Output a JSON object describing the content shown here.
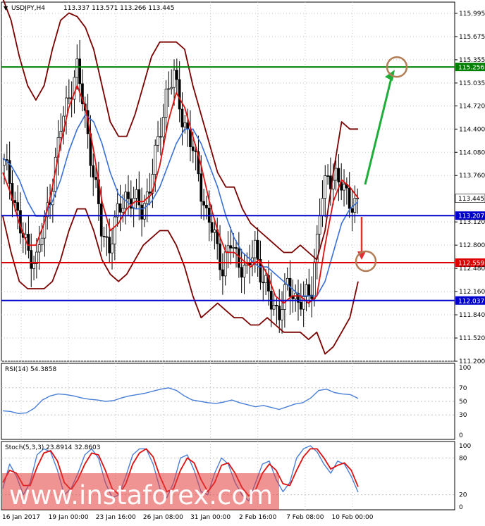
{
  "chart_data": [
    {
      "type": "candlestick",
      "title": "USDJPY,H4",
      "ohlc_text": "113.337 113.571 113.266 113.445",
      "ylim": [
        111.2,
        116.15
      ],
      "y_ticks": [
        "115.995",
        "115.675",
        "115.355",
        "115.035",
        "114.720",
        "114.400",
        "114.080",
        "113.760",
        "113.120",
        "112.800",
        "112.480",
        "112.160",
        "111.840",
        "111.520",
        "111.200"
      ],
      "x_ticks": [
        "16 Jan 2017",
        "19 Jan 00:00",
        "23 Jan 16:00",
        "26 Jan 08:00",
        "31 Jan 00:00",
        "2 Feb 16:00",
        "7 Feb 08:00",
        "10 Feb 00:00"
      ],
      "current_price": {
        "label": "113.445",
        "value": 113.445,
        "color": "#000000"
      },
      "levels": [
        {
          "label": "115.256",
          "value": 115.256,
          "color": "#008000"
        },
        {
          "label": "113.207",
          "value": 113.207,
          "color": "#0000cc"
        },
        {
          "label": "112.559",
          "value": 112.559,
          "color": "#dd0000"
        },
        {
          "label": "112.037",
          "value": 112.037,
          "color": "#0000cc"
        }
      ],
      "close_series": [
        113.9,
        113.6,
        113.0,
        112.7,
        112.6,
        113.1,
        113.7,
        114.4,
        114.9,
        115.2,
        114.6,
        113.8,
        113.0,
        112.8,
        113.2,
        113.5,
        113.4,
        113.3,
        113.6,
        114.2,
        114.9,
        115.1,
        114.6,
        114.2,
        113.8,
        113.2,
        112.9,
        112.5,
        112.8,
        112.6,
        112.4,
        112.8,
        112.3,
        112.0,
        111.9,
        112.2,
        112.1,
        112.0,
        112.2,
        113.3,
        113.7,
        113.8,
        113.5,
        113.4
      ],
      "ma_red": [
        113.8,
        113.5,
        113.1,
        112.8,
        112.8,
        113.1,
        113.6,
        114.2,
        114.7,
        115.0,
        114.7,
        114.1,
        113.4,
        113.0,
        113.1,
        113.3,
        113.4,
        113.4,
        113.5,
        113.9,
        114.5,
        114.9,
        114.7,
        114.3,
        113.9,
        113.4,
        113.0,
        112.7,
        112.7,
        112.6,
        112.5,
        112.6,
        112.4,
        112.1,
        112.0,
        112.1,
        112.1,
        112.0,
        112.1,
        112.8,
        113.4,
        113.7,
        113.6,
        113.45
      ],
      "ma_blue": [
        114.0,
        113.9,
        113.7,
        113.4,
        113.2,
        113.2,
        113.4,
        113.7,
        114.1,
        114.4,
        114.6,
        114.5,
        114.2,
        113.8,
        113.5,
        113.4,
        113.3,
        113.3,
        113.4,
        113.6,
        113.9,
        114.2,
        114.4,
        114.4,
        114.2,
        113.9,
        113.6,
        113.2,
        112.9,
        112.7,
        112.6,
        112.5,
        112.5,
        112.4,
        112.3,
        112.2,
        112.1,
        112.1,
        112.1,
        112.3,
        112.7,
        113.1,
        113.3,
        113.4
      ],
      "bb_upper": [
        116.2,
        115.9,
        115.4,
        115.0,
        114.8,
        115.0,
        115.5,
        115.9,
        116.0,
        115.95,
        115.8,
        115.5,
        115.0,
        114.5,
        114.3,
        114.3,
        114.6,
        115.0,
        115.4,
        115.6,
        115.6,
        115.6,
        115.5,
        115.0,
        114.6,
        114.2,
        113.8,
        113.6,
        113.6,
        113.3,
        113.1,
        113.0,
        112.9,
        112.8,
        112.7,
        112.7,
        112.8,
        112.7,
        112.6,
        113.0,
        113.8,
        114.5,
        114.4,
        114.4
      ],
      "bb_lower": [
        113.2,
        112.7,
        112.3,
        112.2,
        112.2,
        112.2,
        112.3,
        112.6,
        113.0,
        113.3,
        113.3,
        113.0,
        112.6,
        112.4,
        112.3,
        112.4,
        112.6,
        112.8,
        112.9,
        113.0,
        113.0,
        112.8,
        112.5,
        112.1,
        111.8,
        111.9,
        112.0,
        111.9,
        111.8,
        111.8,
        111.7,
        111.7,
        111.8,
        111.7,
        111.6,
        111.6,
        111.6,
        111.5,
        111.6,
        111.3,
        111.4,
        111.6,
        111.8,
        112.3
      ]
    },
    {
      "type": "line",
      "title": "RSI(14) 54.3858",
      "ylim": [
        0,
        100
      ],
      "y_ticks": [
        "100",
        "70",
        "50",
        "30",
        "0"
      ],
      "values": [
        36,
        35,
        32,
        33,
        40,
        52,
        58,
        61,
        60,
        58,
        55,
        53,
        52,
        50,
        51,
        55,
        58,
        60,
        62,
        65,
        68,
        70,
        66,
        58,
        52,
        50,
        48,
        47,
        49,
        52,
        48,
        45,
        42,
        44,
        41,
        38,
        42,
        46,
        48,
        55,
        66,
        68,
        63,
        61,
        60,
        54.4
      ]
    },
    {
      "type": "line",
      "title": "Stoch(5,3,3) 23.8914 32.8603",
      "ylim": [
        0,
        100
      ],
      "y_ticks": [
        "100",
        "80",
        "20",
        "0"
      ],
      "main": [
        30,
        70,
        50,
        20,
        40,
        85,
        95,
        90,
        60,
        20,
        30,
        55,
        85,
        95,
        80,
        40,
        15,
        20,
        50,
        85,
        95,
        95,
        70,
        30,
        15,
        40,
        80,
        85,
        60,
        25,
        20,
        55,
        80,
        70,
        40,
        20,
        10,
        40,
        70,
        75,
        45,
        25,
        40,
        80,
        95,
        100,
        90,
        70,
        55,
        75,
        70,
        50,
        24
      ],
      "signal": [
        40,
        60,
        55,
        35,
        35,
        65,
        88,
        92,
        75,
        40,
        28,
        45,
        70,
        88,
        85,
        60,
        30,
        20,
        38,
        70,
        88,
        95,
        82,
        50,
        25,
        30,
        60,
        80,
        72,
        45,
        25,
        40,
        68,
        72,
        55,
        32,
        18,
        28,
        55,
        70,
        60,
        38,
        35,
        60,
        82,
        95,
        95,
        80,
        62,
        68,
        72,
        60,
        33
      ]
    }
  ],
  "watermark": {
    "text": "www.instaforex.com"
  },
  "forecast": {
    "target_up": "115.256",
    "target_down": "112.559"
  }
}
